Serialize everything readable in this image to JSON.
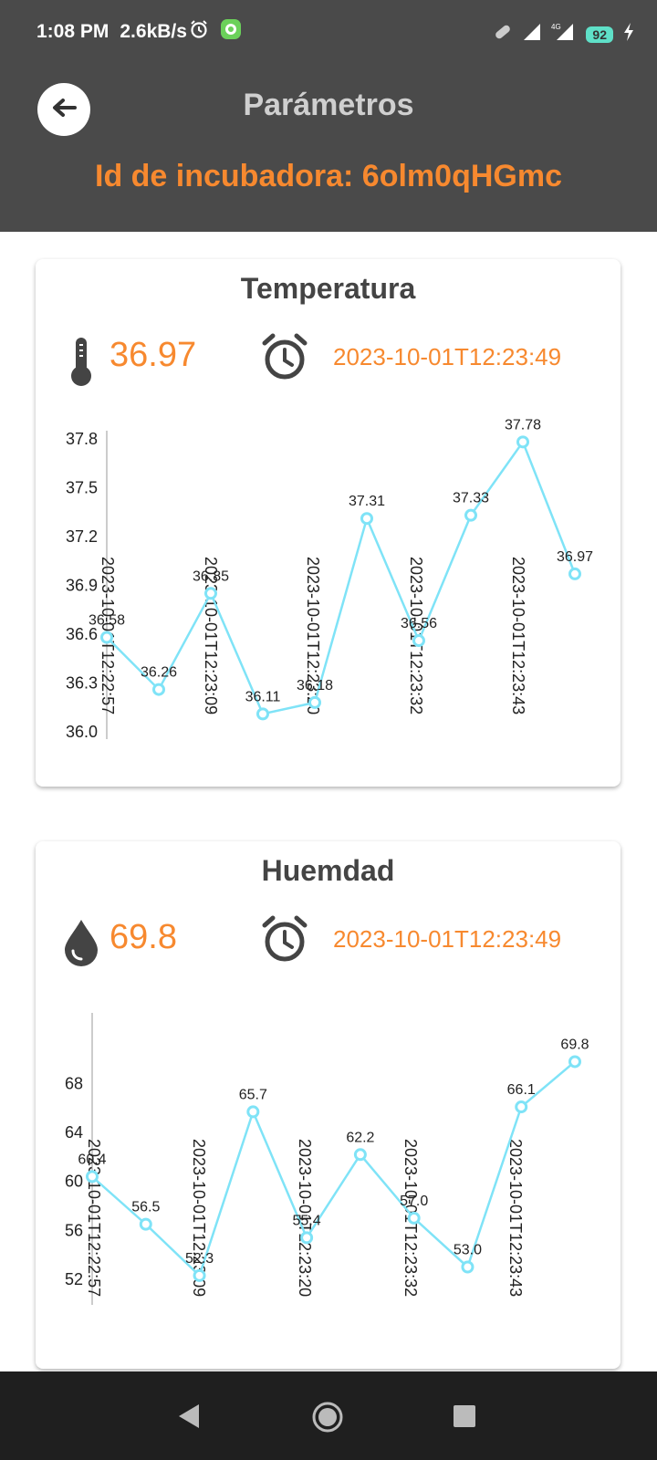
{
  "status_bar": {
    "time": "1:08 PM",
    "speed": "2.6kB/s",
    "battery": "92",
    "icons": [
      "alarm-icon",
      "app-notification-icon",
      "link-icon",
      "signal-icon",
      "signal-4g-icon",
      "battery-icon",
      "charging-icon"
    ]
  },
  "header": {
    "title": "Parámetros",
    "incubator_label": "Id de incubadora: 6olm0qHGmc",
    "back_icon": "arrow-left-icon"
  },
  "temperature_card": {
    "title": "Temperatura",
    "value": "36.97",
    "timestamp": "2023-10-01T12:23:49",
    "icon": "thermometer-icon",
    "clock_icon": "alarm-clock-icon"
  },
  "humidity_card": {
    "title": "Huemdad",
    "value": "69.8",
    "timestamp": "2023-10-01T12:23:49",
    "icon": "water-drop-icon",
    "clock_icon": "alarm-clock-icon"
  },
  "chart_data": [
    {
      "type": "line",
      "title": "",
      "xlabel": "",
      "ylabel": "",
      "ylim": [
        36.0,
        37.95
      ],
      "y_ticks": [
        "36.0",
        "36.3",
        "36.6",
        "36.9",
        "37.2",
        "37.5",
        "37.8"
      ],
      "x_tick_labels": [
        "2023-10-01T12:22:57",
        "2023-10-01T12:23:09",
        "2023-10-01T12:23:20",
        "2023-10-01T12:23:32",
        "2023-10-01T12:23:43"
      ],
      "series": [
        {
          "values": [
            36.58,
            36.26,
            36.85,
            36.11,
            36.18,
            37.31,
            36.56,
            37.33,
            37.78,
            36.97
          ],
          "labels": [
            "36.58",
            "36.26",
            "36.85",
            "36.11",
            "36.18",
            "37.31",
            "36.56",
            "37.33",
            "37.78",
            "36.97"
          ],
          "color": "#7fe3f7"
        }
      ]
    },
    {
      "type": "line",
      "title": "",
      "xlabel": "",
      "ylabel": "",
      "ylim": [
        50.5,
        72
      ],
      "y_ticks": [
        "52",
        "56",
        "60",
        "64",
        "68"
      ],
      "x_tick_labels": [
        "2023-10-01T12:22:57",
        "2023-10-01T12:23:09",
        "2023-10-01T12:23:20",
        "2023-10-01T12:23:32",
        "2023-10-01T12:23:43"
      ],
      "series": [
        {
          "values": [
            60.4,
            56.5,
            52.3,
            65.7,
            55.4,
            62.2,
            57.0,
            53.0,
            66.1,
            69.8
          ],
          "labels": [
            "60.4",
            "56.5",
            "52.3",
            "65.7",
            "55.4",
            "62.2",
            "57.0",
            "53.0",
            "66.1",
            "69.8"
          ],
          "color": "#7fe3f7"
        }
      ]
    }
  ],
  "nav_bar": {
    "buttons": [
      "back-triangle-icon",
      "home-circle-icon",
      "recents-square-icon"
    ]
  }
}
